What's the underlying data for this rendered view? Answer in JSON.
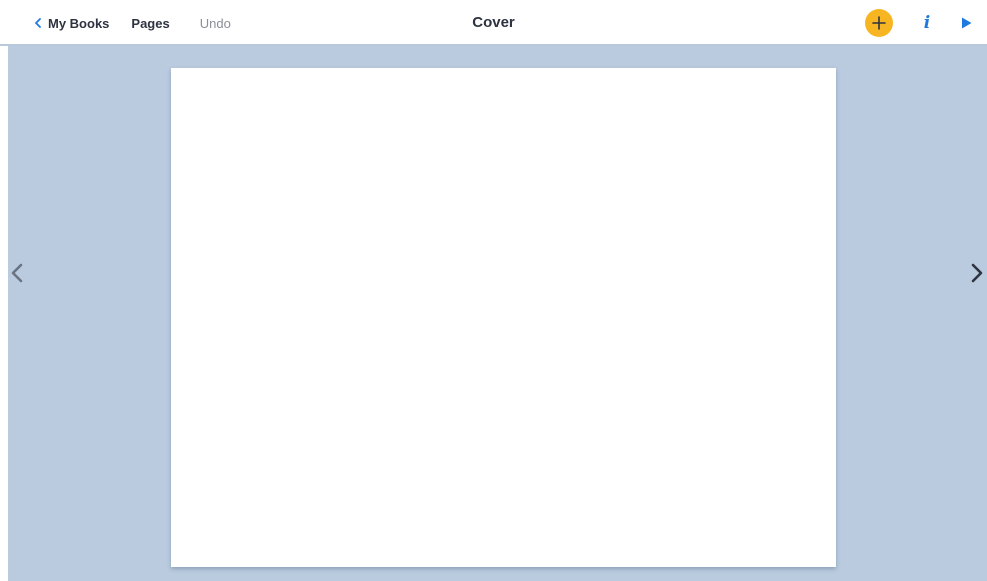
{
  "toolbar": {
    "back_label": "My Books",
    "pages_label": "Pages",
    "undo_label": "Undo",
    "title": "Cover",
    "info_label": "i"
  },
  "icons": {
    "back": "chevron-left-icon",
    "add": "plus-icon",
    "info": "info-icon",
    "play": "play-icon",
    "prev": "chevron-left-icon",
    "next": "chevron-right-icon"
  },
  "colors": {
    "accent": "#1f7ae0",
    "add_button": "#f7b522",
    "workspace_bg": "#bacbdf",
    "text_dark": "#2d3340",
    "text_muted": "#8a8f98"
  }
}
